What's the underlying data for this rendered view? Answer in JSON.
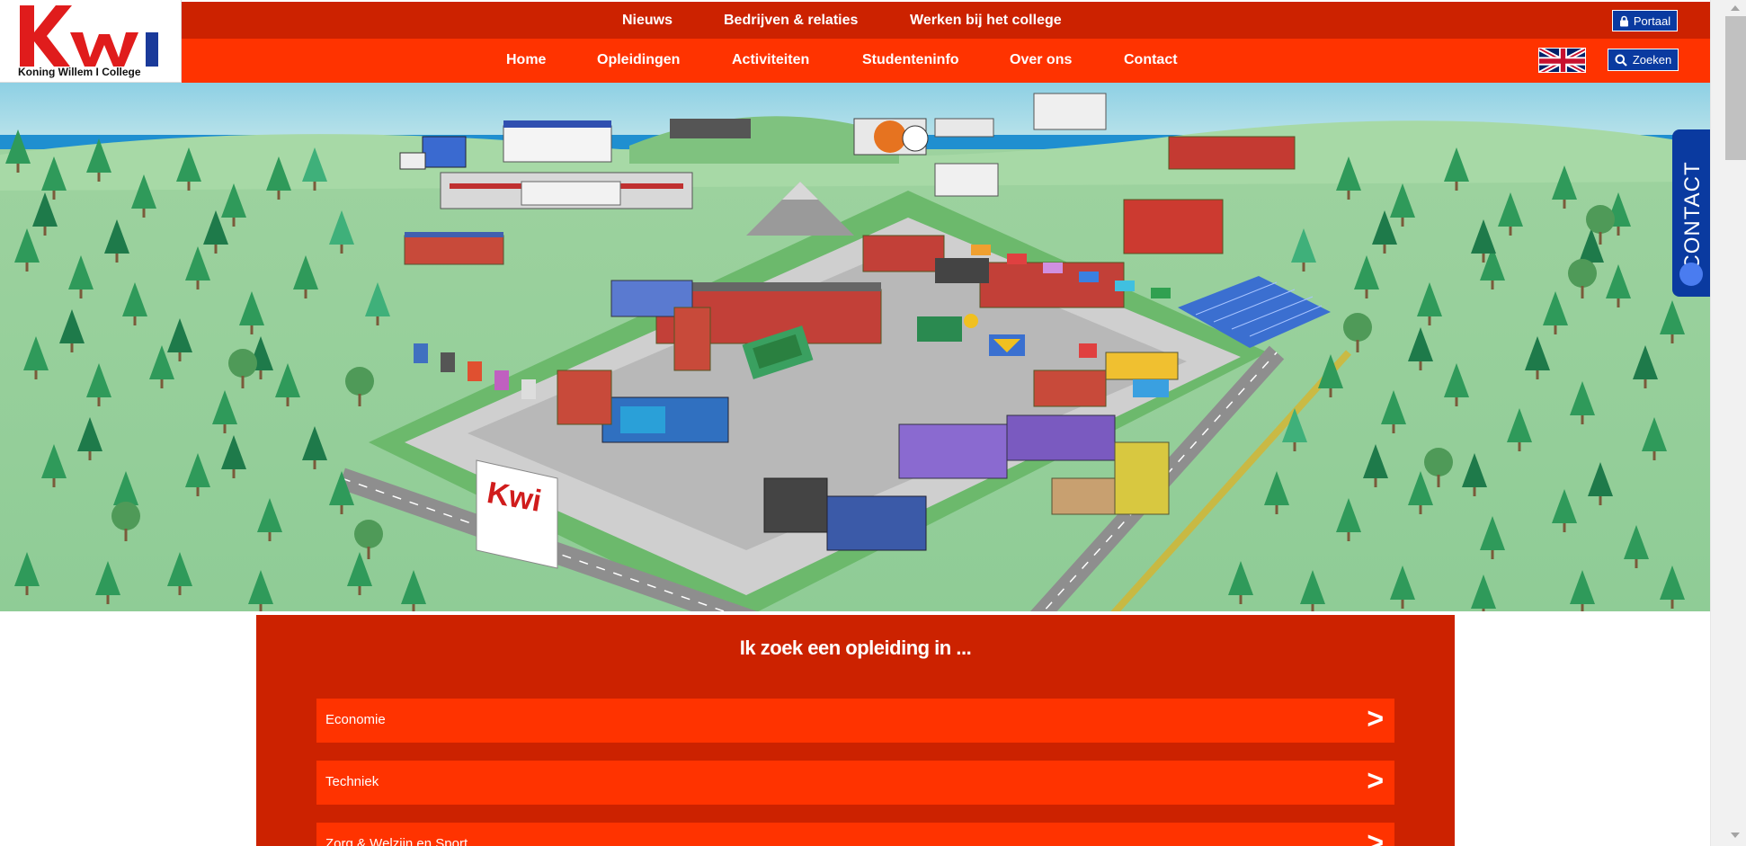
{
  "brand": {
    "logo_text": "Koning Willem I College",
    "colors": {
      "red_dark": "#cc2200",
      "red": "#ff3300",
      "blue": "#0a3aa0"
    }
  },
  "topbar": {
    "links": [
      "Nieuws",
      "Bedrijven & relaties",
      "Werken bij het college"
    ],
    "portal_label": "Portaal"
  },
  "mainnav": {
    "links": [
      "Home",
      "Opleidingen",
      "Activiteiten",
      "Studenteninfo",
      "Over ons",
      "Contact"
    ],
    "search_label": "Zoeken",
    "language_flag": "uk-flag-icon"
  },
  "contact_tab": {
    "label": "CONTACT"
  },
  "finder": {
    "title": "Ik zoek een opleiding in ...",
    "items": [
      {
        "label": "Economie",
        "arrow": ">"
      },
      {
        "label": "Techniek",
        "arrow": ">"
      },
      {
        "label": "Zorg & Welzijn en Sport",
        "arrow": ">"
      }
    ]
  }
}
